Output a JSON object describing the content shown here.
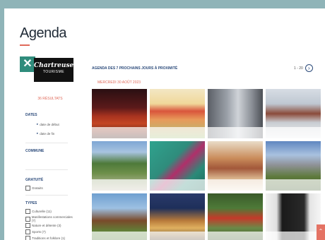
{
  "page": {
    "title": "Agenda"
  },
  "sidebar": {
    "logo": {
      "line1": "Chartreuse",
      "line2": "TOURISME",
      "line3": ""
    },
    "results": "36 RÉSULTATS",
    "dates_title": "DATES",
    "date_start": "date de début",
    "date_end": "date de fin",
    "commune_title": "COMMUNE",
    "gratuite_title": "GRATUITÉ",
    "gratuit_label": "Gratuits",
    "types_title": "TYPES",
    "types": [
      "Culturelle (11)",
      "Manifestations commerciales (7)",
      "Nature et détente (3)",
      "Sports (7)",
      "Traditions et folklore (1)"
    ]
  },
  "main": {
    "heading": "AGENDA DES 7 PROCHAINS JOURS À PROXIMITÉ",
    "pager": "1 - 20",
    "date_line": "MERCREDI 30 AOÛT 2023",
    "cards": [
      {
        "caption1": "",
        "caption2": ""
      },
      {
        "caption1": "",
        "caption2": ""
      },
      {
        "caption1": "",
        "caption2": ""
      },
      {
        "caption1": "",
        "caption2": ""
      },
      {
        "caption1": "",
        "caption2": ""
      },
      {
        "caption1": "",
        "caption2": ""
      },
      {
        "caption1": "",
        "caption2": ""
      },
      {
        "caption1": "",
        "caption2": ""
      },
      {
        "caption1": "",
        "caption2": ""
      },
      {
        "caption1": "",
        "caption2": ""
      },
      {
        "caption1": "",
        "caption2": ""
      },
      {
        "caption1": "",
        "caption2": ""
      }
    ]
  },
  "colors": {
    "accent": "#e06a5a",
    "brand": "#2b4a7a",
    "close": "#2f8c7c"
  },
  "icons": {
    "close": "close-icon",
    "next": "chevron-right-icon",
    "scroll_top": "chevron-up-icon"
  }
}
